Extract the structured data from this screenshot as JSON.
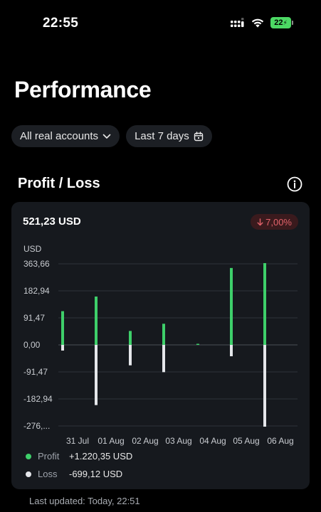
{
  "status_bar": {
    "time": "22:55",
    "battery": "22"
  },
  "page": {
    "title": "Performance"
  },
  "filters": {
    "accounts": "All real accounts",
    "period": "Last 7 days"
  },
  "section": {
    "title": "Profit / Loss"
  },
  "card": {
    "total": "521,23 USD",
    "change": "7,00%"
  },
  "colors": {
    "profit": "#3ecf6a",
    "loss": "#e4e6ea",
    "negative": "#e2626a",
    "card_bg": "#16191e"
  },
  "chart_data": {
    "type": "bar",
    "ylabel": "USD",
    "y_ticks": [
      "363,66",
      "182,94",
      "91,47",
      "0,00",
      "-91,47",
      "-182,94",
      "-276,..."
    ],
    "categories": [
      "31 Jul",
      "01 Aug",
      "02 Aug",
      "03 Aug",
      "04 Aug",
      "05 Aug",
      "06 Aug"
    ],
    "series": [
      {
        "name": "Profit",
        "values": [
          150,
          215,
          62,
          94,
          3,
          342,
          363.66
        ]
      },
      {
        "name": "Loss",
        "values": [
          -25,
          -265,
          -90,
          -120,
          0,
          -50,
          -360
        ]
      }
    ],
    "ylim": [
      -360,
      363.66
    ],
    "grid": true
  },
  "legend": {
    "profit_label": "Profit",
    "profit_value": "+1.220,35 USD",
    "loss_label": "Loss",
    "loss_value": "-699,12 USD"
  },
  "footer": {
    "last_updated": "Last updated: Today, 22:51"
  }
}
